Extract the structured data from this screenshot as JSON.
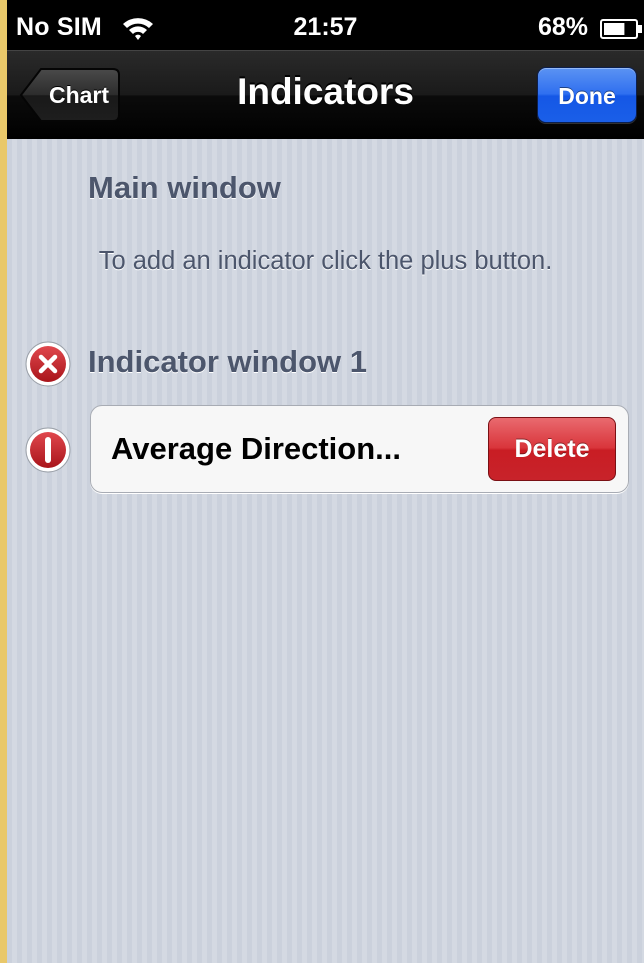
{
  "status_bar": {
    "carrier": "No SIM",
    "time": "21:57",
    "battery_percent": "68%",
    "battery_level": 0.68,
    "wifi_icon": "wifi-icon",
    "battery_icon": "battery-icon"
  },
  "nav_bar": {
    "back_label": "Chart",
    "title": "Indicators",
    "done_label": "Done"
  },
  "sections": {
    "main_window": {
      "title": "Main window",
      "footer": "To add an indicator click the plus button."
    },
    "indicator_window": {
      "title": "Indicator window 1",
      "delete_section_icon": "remove-circle-icon",
      "rows": [
        {
          "label": "Average Direction...",
          "delete_label": "Delete",
          "edit_icon": "delete-rotated-icon"
        }
      ]
    }
  },
  "colors": {
    "done_blue": "#2f6ff0",
    "delete_red": "#d9353b",
    "section_text": "#4c566c"
  }
}
